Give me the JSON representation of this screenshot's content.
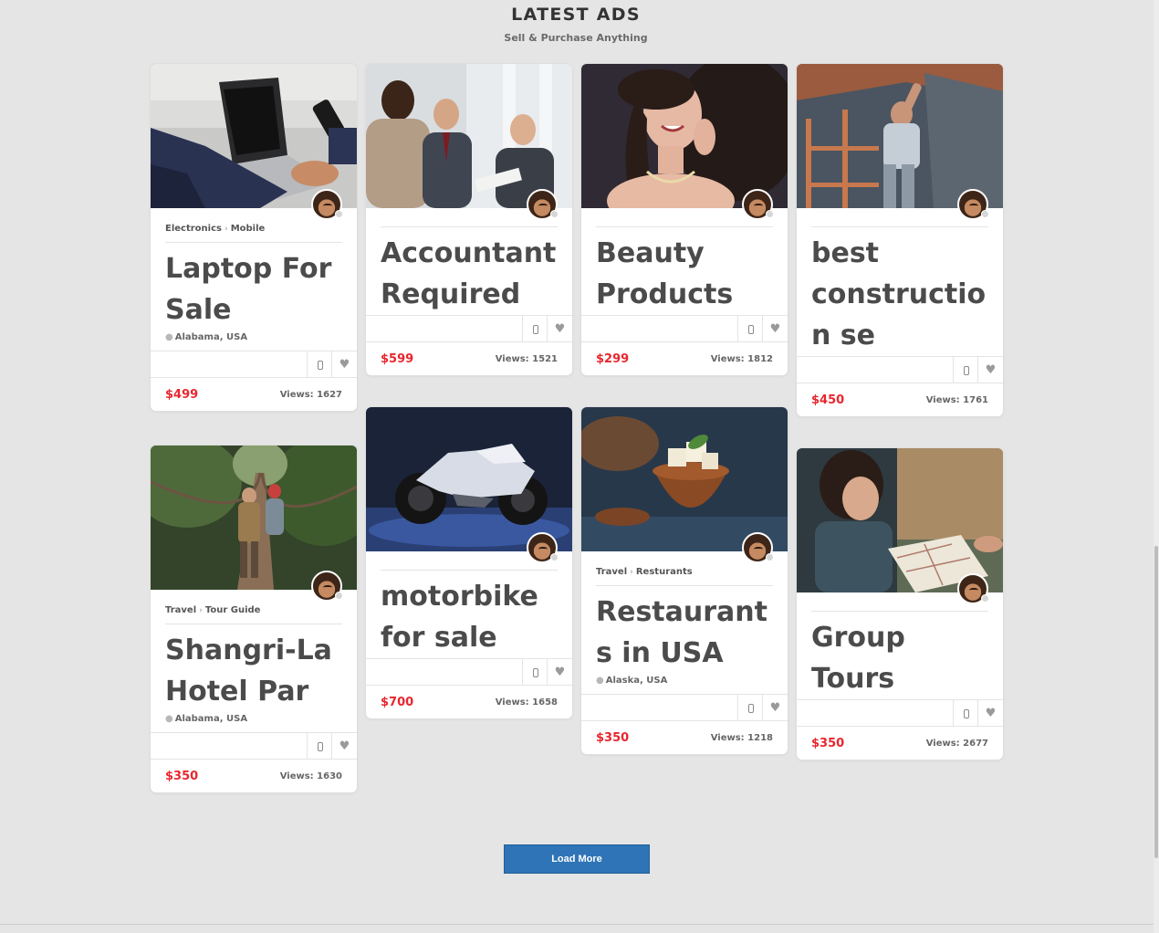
{
  "section": {
    "title": "LATEST ADS",
    "subtitle": "Sell & Purchase Anything"
  },
  "load_more_label": "Load More",
  "colors": {
    "price": "#e8262f",
    "button": "#2e74b6",
    "background": "#e5e5e5"
  },
  "icons": {
    "phone": "phone-icon",
    "favorite": "heart-icon",
    "location": "map-pin-icon",
    "separator": "chevron-right-icon"
  },
  "ads": [
    {
      "category": "Electronics",
      "subcategory": "Mobile",
      "title": "Laptop For Sale",
      "location": "Alabama, USA",
      "price": "$499",
      "views": "Views: 1627",
      "photo": "laptop-photo"
    },
    {
      "title": "Accountant Required",
      "price": "$599",
      "views": "Views: 1521",
      "photo": "business-meeting-photo"
    },
    {
      "title": "Beauty Products",
      "price": "$299",
      "views": "Views: 1812",
      "photo": "beauty-photo"
    },
    {
      "title": "best construction se",
      "price": "$450",
      "views": "Views: 1761",
      "photo": "construction-photo"
    },
    {
      "category": "Travel",
      "subcategory": "Tour Guide",
      "title": "Shangri-La Hotel Par",
      "location": "Alabama, USA",
      "price": "$350",
      "views": "Views: 1630",
      "photo": "rope-bridge-photo"
    },
    {
      "title": "motorbike for sale",
      "price": "$700",
      "views": "Views: 1658",
      "photo": "motorbike-photo"
    },
    {
      "category": "Travel",
      "subcategory": "Resturants",
      "title": "Restaurants in USA",
      "location": "Alaska, USA",
      "price": "$350",
      "views": "Views: 1218",
      "photo": "food-bowl-photo"
    },
    {
      "title": "Group Tours",
      "price": "$350",
      "views": "Views: 2677",
      "photo": "car-map-photo"
    }
  ]
}
